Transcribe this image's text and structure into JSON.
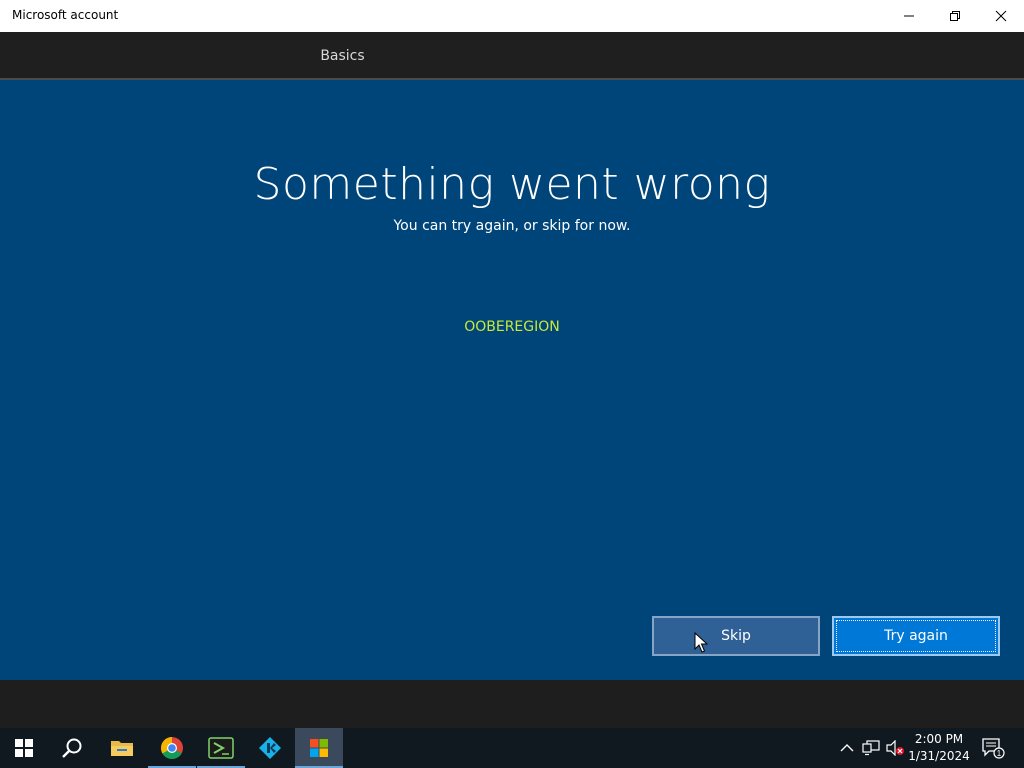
{
  "window": {
    "title": "Microsoft account"
  },
  "tabs": [
    {
      "label": "Basics",
      "active": true
    }
  ],
  "main": {
    "heading": "Something went wrong",
    "subtext": "You can try again, or skip for now.",
    "region_code": "OOBEREGION",
    "skip_label": "Skip",
    "try_again_label": "Try again"
  },
  "taskbar": {
    "apps": [
      "start-icon",
      "search-icon",
      "file-explorer-icon",
      "chrome-icon",
      "terminal-app-icon",
      "kodi-icon",
      "microsoft-store-icon"
    ],
    "time": "2:00 PM",
    "date": "1/31/2024",
    "notification_count": "1"
  },
  "colors": {
    "panel_bg": "#00457a",
    "accent": "#0078d7",
    "region_text": "#c8e83a"
  }
}
